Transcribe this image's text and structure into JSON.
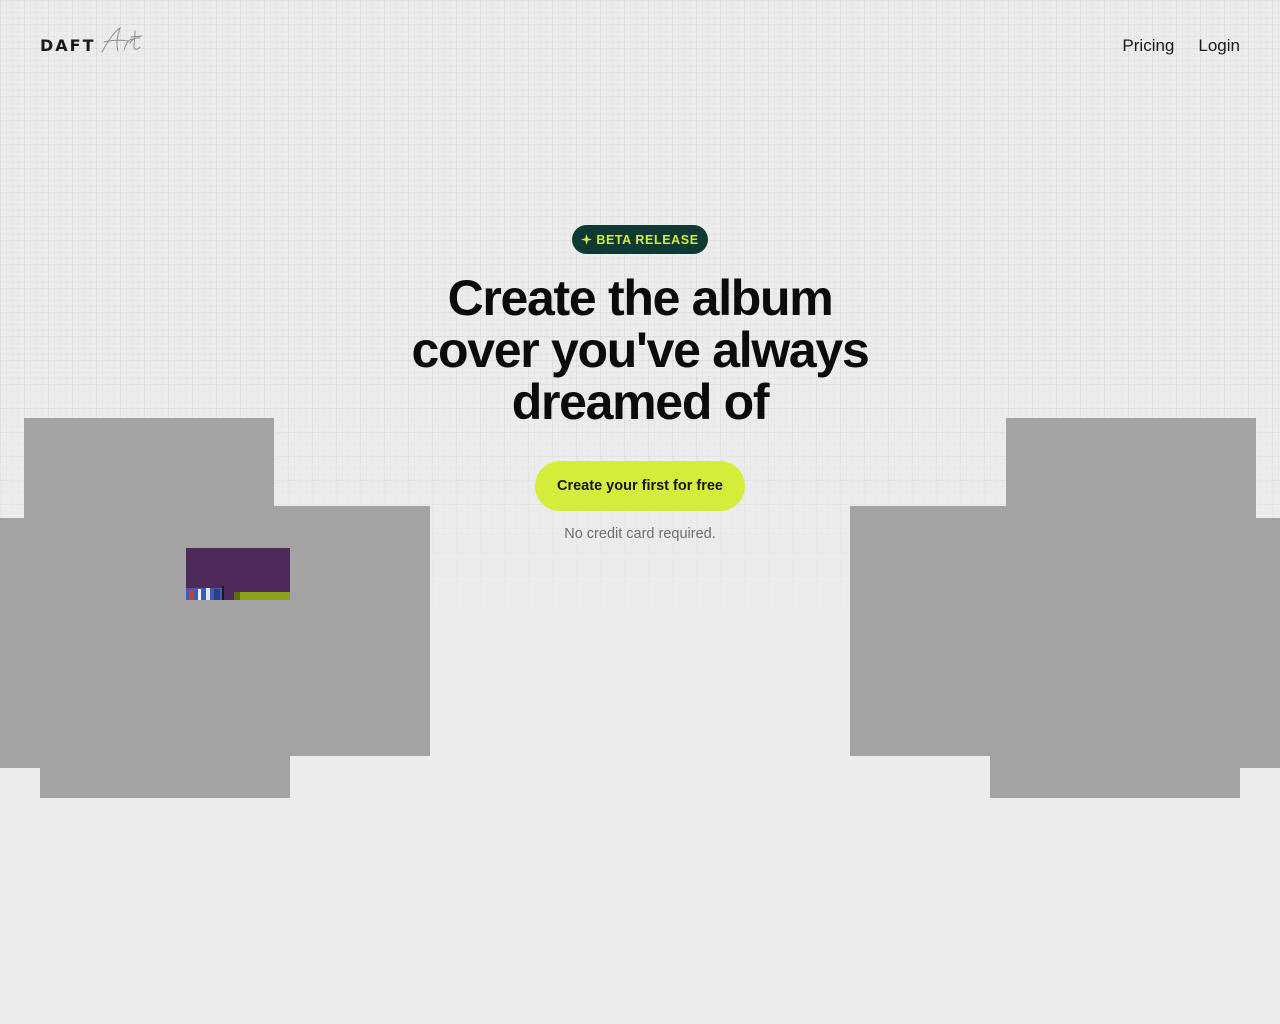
{
  "header": {
    "logo": {
      "word": "DAFT",
      "script": "Art"
    },
    "nav": [
      {
        "label": "Pricing"
      },
      {
        "label": "Login"
      }
    ]
  },
  "hero": {
    "badge": {
      "icon": "sparkle-icon",
      "text": "BETA RELEASE"
    },
    "headline_lines": [
      "Create the album",
      "cover you've always",
      "dreamed of"
    ],
    "cta_label": "Create your first for free",
    "note": "No credit card required."
  },
  "colors": {
    "background": "#ececec",
    "badge_bg": "#0e3a33",
    "accent": "#d6ec3a",
    "cover_placeholder": "#a3a3a3",
    "thumb_purple": "#4e2a5c",
    "thumb_green": "#8aa21a"
  }
}
